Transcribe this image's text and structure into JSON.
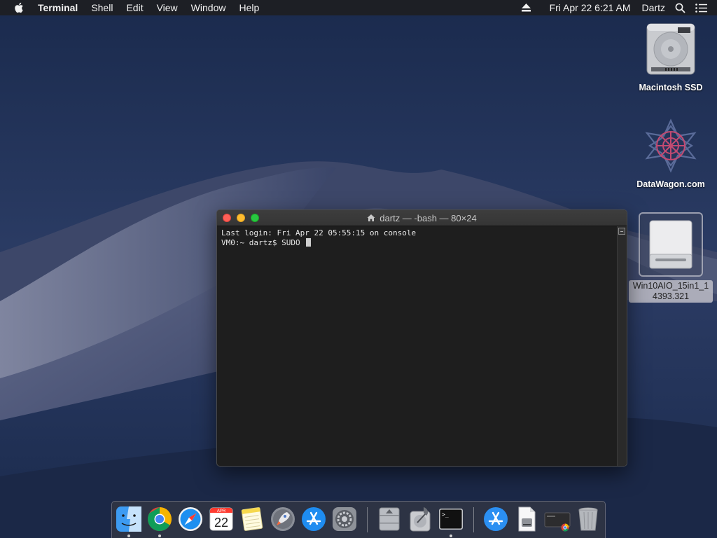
{
  "menubar": {
    "app_name": "Terminal",
    "menus": [
      "Shell",
      "Edit",
      "View",
      "Window",
      "Help"
    ],
    "clock": "Fri Apr 22  6:21 AM",
    "user": "Dartz"
  },
  "desktop": {
    "icons": [
      {
        "label": "Macintosh SSD",
        "icon": "hard-drive-icon"
      },
      {
        "label": "DataWagon.com",
        "icon": "datawagon-logo-icon"
      },
      {
        "label": "Win10AIO_15in1_14393.321",
        "icon": "removable-disk-icon",
        "selected": true
      }
    ]
  },
  "terminal": {
    "title": "dartz — -bash — 80×24",
    "lines": [
      "Last login: Fri Apr 22 05:55:15 on console",
      "VM0:~ dartz$ SUDO "
    ]
  },
  "dock": {
    "items": [
      {
        "name": "Finder",
        "icon": "finder-icon",
        "running": true
      },
      {
        "name": "Google Chrome",
        "icon": "chrome-icon",
        "running": true
      },
      {
        "name": "Safari",
        "icon": "safari-icon",
        "running": false
      },
      {
        "name": "Calendar",
        "icon": "calendar-icon",
        "running": false,
        "month": "APR",
        "day": "22"
      },
      {
        "name": "Notes",
        "icon": "notes-icon",
        "running": false
      },
      {
        "name": "Launchpad",
        "icon": "launchpad-icon",
        "running": false
      },
      {
        "name": "App Store",
        "icon": "app-store-icon",
        "running": false
      },
      {
        "name": "System Preferences",
        "icon": "system-preferences-icon",
        "running": false
      },
      {
        "name": "Boot Camp Assistant",
        "icon": "boot-camp-icon",
        "running": false
      },
      {
        "name": "Disk Utility",
        "icon": "disk-utility-icon",
        "running": false
      },
      {
        "name": "Terminal",
        "icon": "terminal-icon",
        "running": true,
        "glyph": ">_"
      },
      {
        "name": "App Store Download",
        "icon": "app-store-folder-icon",
        "running": false
      },
      {
        "name": "Disk Image",
        "icon": "disk-image-icon",
        "running": false
      },
      {
        "name": "Chrome Window",
        "icon": "chrome-window-icon",
        "running": false
      },
      {
        "name": "Trash",
        "icon": "trash-icon",
        "running": false
      }
    ]
  }
}
